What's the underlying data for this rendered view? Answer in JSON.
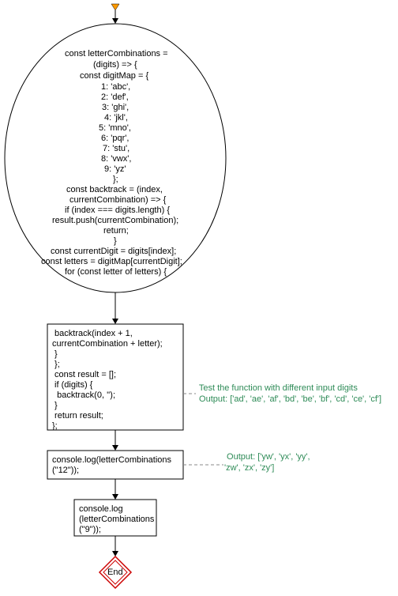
{
  "start_marker": "▾",
  "ellipse_lines": [
    "const letterCombinations =",
    "(digits) => {",
    "const digitMap = {",
    "1: 'abc',",
    "2: 'def',",
    "3: 'ghi',",
    "4: 'jkl',",
    "5: 'mno',",
    "6: 'pqr',",
    "7: 'stu',",
    "8: 'vwx',",
    "9: 'yz'",
    "};",
    "const backtrack = (index,",
    "currentCombination) => {",
    "if (index === digits.length) {",
    "result.push(currentCombination);",
    "return;",
    "}",
    "const currentDigit = digits[index];",
    "const letters = digitMap[currentDigit];",
    "for (const letter of letters) {"
  ],
  "box1_lines": [
    " backtrack(index + 1,",
    "currentCombination + letter);",
    " }",
    " };",
    " const result = [];",
    " if (digits) {",
    "  backtrack(0, '');",
    " }",
    " return result;",
    "};"
  ],
  "box2_lines": [
    "console.log(letterCombinations",
    "(\"12\"));"
  ],
  "box3_lines": [
    "console.log",
    "(letterCombinations",
    "(\"9\"));"
  ],
  "comment1": " Test the function with different input digits\n Output: ['ad', 'ae', 'af', 'bd', 'be', 'bf', 'cd', 'ce', 'cf']",
  "comment2": " Output: ['yw', 'yx', 'yy',\n'zw', 'zx', 'zy']",
  "end_label": "End"
}
